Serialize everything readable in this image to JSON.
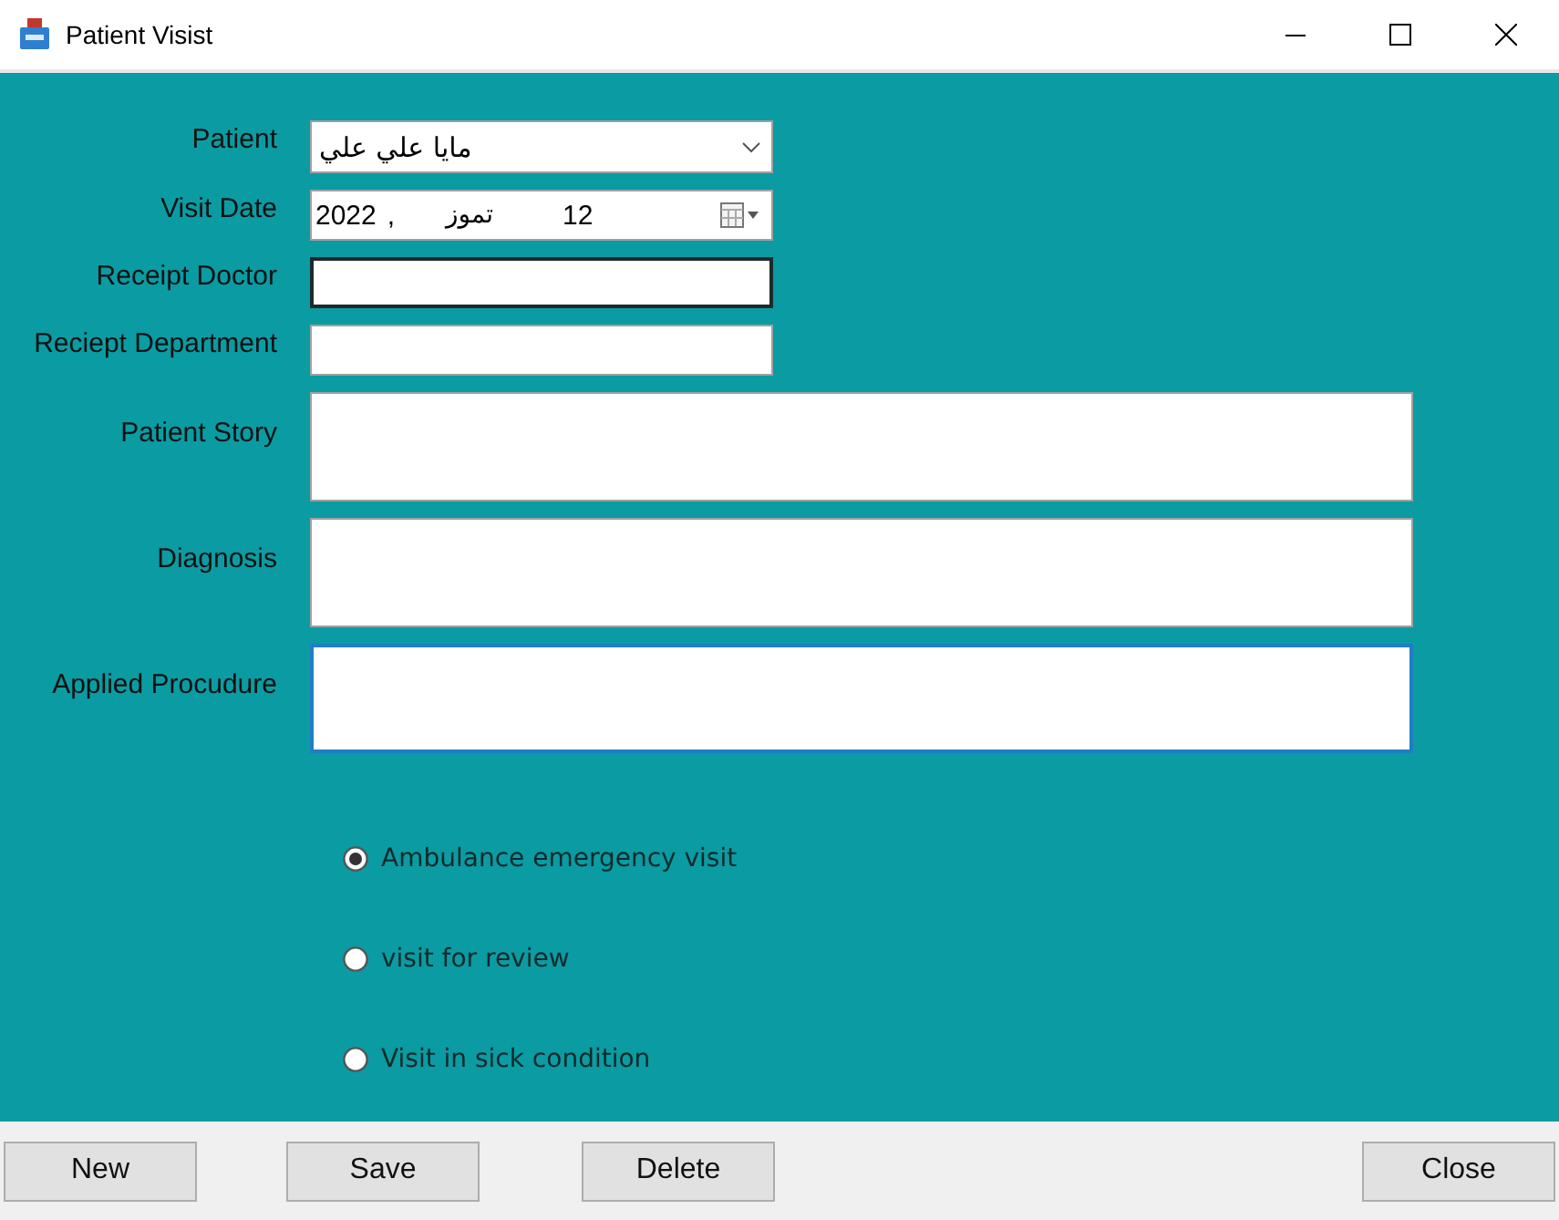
{
  "window": {
    "title": "Patient Visist"
  },
  "form": {
    "patient": {
      "label": "Patient",
      "value": "مايا علي علي"
    },
    "visit_date": {
      "label": "Visit Date",
      "year": "2022",
      "separator": ",",
      "month": "تموز",
      "day": "12"
    },
    "fields": [
      {
        "label": "Receipt Doctor",
        "kind": "line",
        "hovered": true,
        "focused": false
      },
      {
        "label": "Reciept Department",
        "kind": "line",
        "hovered": false,
        "focused": false
      },
      {
        "label": "Patient Story",
        "kind": "area",
        "hovered": false,
        "focused": false
      },
      {
        "label": "Diagnosis",
        "kind": "area",
        "hovered": false,
        "focused": false
      },
      {
        "label": "Applied Procudure",
        "kind": "area",
        "hovered": false,
        "focused": true
      }
    ],
    "visit_types": [
      {
        "label": "Ambulance emergency visit",
        "selected": true
      },
      {
        "label": "visit for review",
        "selected": false
      },
      {
        "label": "Visit in sick condition",
        "selected": false
      }
    ]
  },
  "buttons": [
    "New",
    "Save",
    "Delete",
    "Close"
  ]
}
